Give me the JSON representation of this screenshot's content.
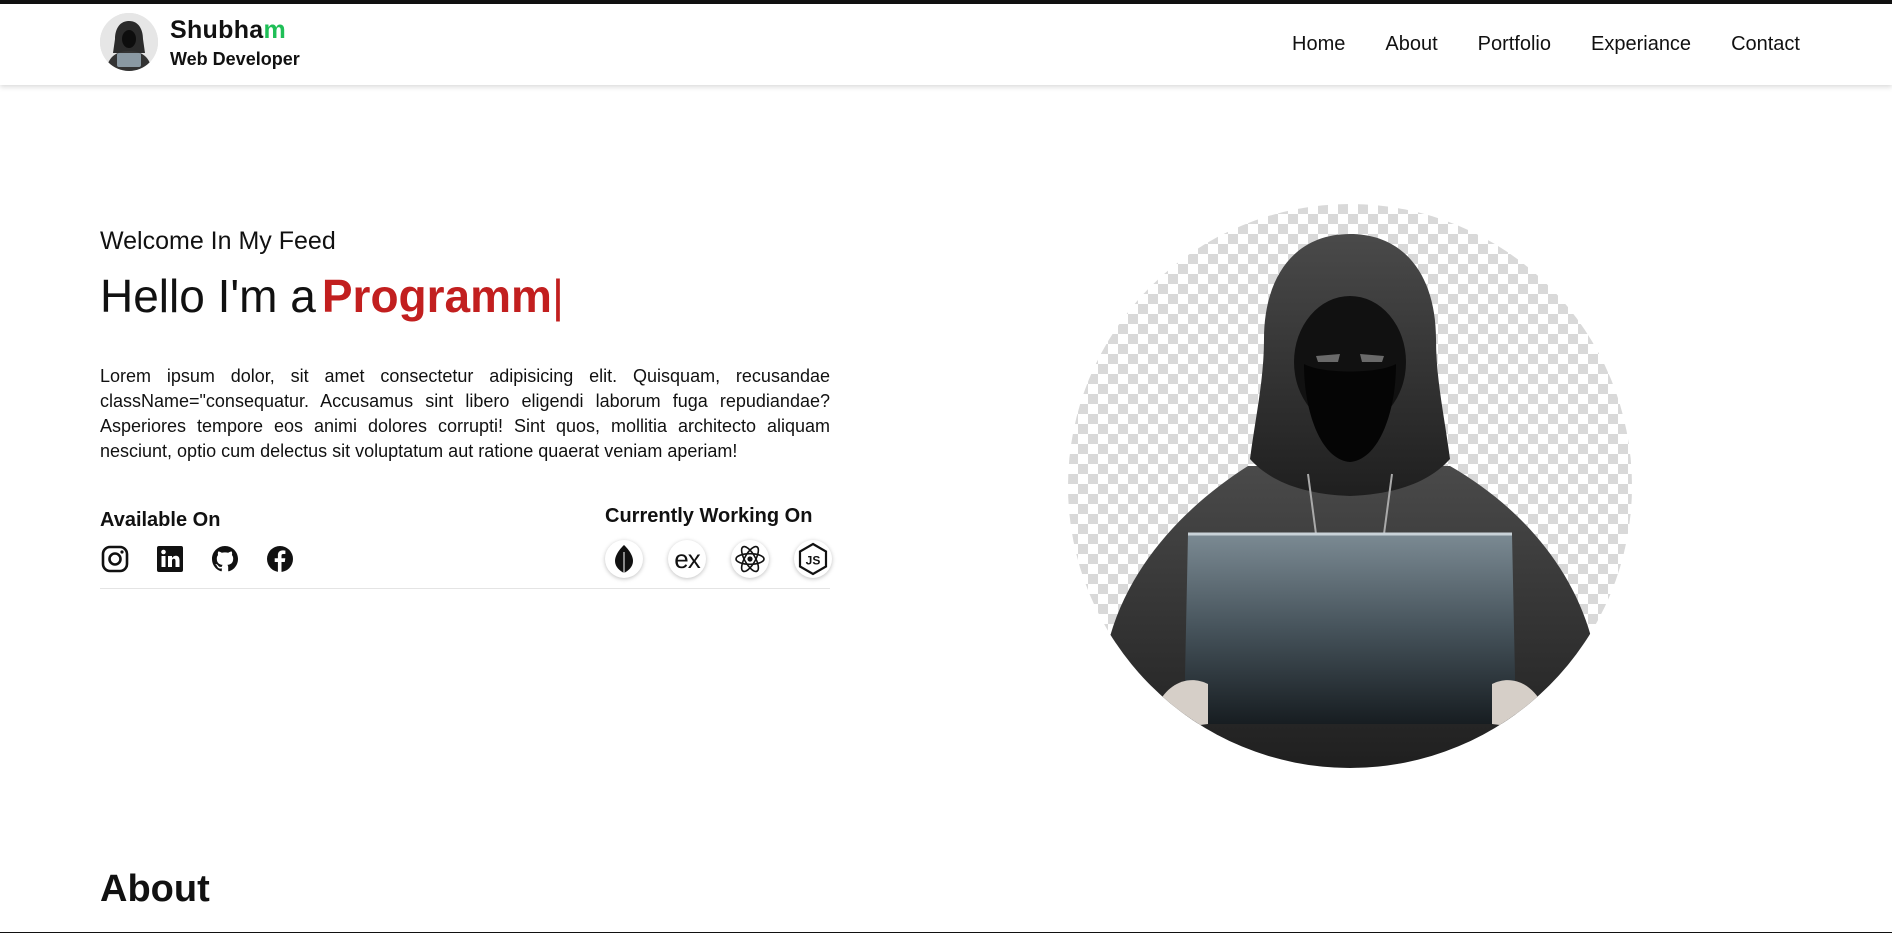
{
  "header": {
    "brand_name": "Shubha",
    "brand_name_accent": "m",
    "brand_role": "Web Developer",
    "accent_color": "#1fbf57",
    "nav": [
      "Home",
      "About",
      "Portfolio",
      "Experiance",
      "Contact"
    ]
  },
  "hero": {
    "welcome": "Welcome In My Feed",
    "headline_prefix": "Hello I'm a",
    "headline_typed": "Programm",
    "cursor": "|",
    "typed_color": "#c21f1f",
    "intro": "Lorem ipsum dolor, sit amet consectetur adipisicing elit. Quisquam, recusandae className=\"consequatur. Accusamus sint libero eligendi laborum fuga repudiandae? Asperiores tempore eos animi dolores corrupti! Sint quos, mollitia architecto aliquam nesciunt, optio cum delectus sit voluptatum aut ratione quaerat veniam aperiam!",
    "available_label": "Available On",
    "social_icons": [
      "instagram-icon",
      "linkedin-icon",
      "github-icon",
      "facebook-icon"
    ],
    "working_label": "Currently Working On",
    "tech_icons": [
      "mongodb-icon",
      "express-icon",
      "react-icon",
      "nodejs-icon"
    ],
    "tech_express_text": "ex",
    "tech_js_text": "JS"
  },
  "about": {
    "title": "About"
  }
}
